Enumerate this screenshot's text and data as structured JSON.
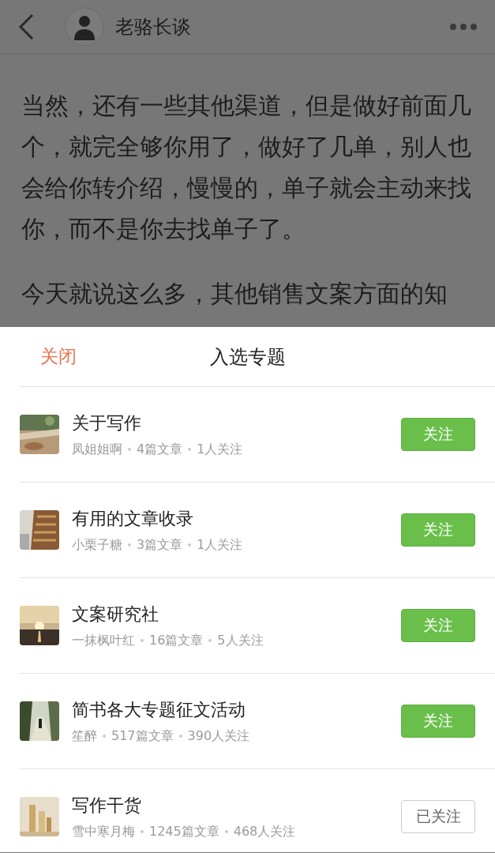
{
  "header": {
    "author": "老骆长谈"
  },
  "article": {
    "paragraphs": [
      "当然，还有一些其他渠道，但是做好前面几个，就完全够你用了，做好了几单，别人也会给你转介绍，慢慢的，单子就会主动来找你，而不是你去找单子了。",
      "今天就说这么多，其他销售文案方面的知"
    ]
  },
  "sheet": {
    "close": "关闭",
    "title": "入选专题",
    "topics": [
      {
        "title": "关于写作",
        "author": "凤姐姐啊",
        "articles": "4篇文章",
        "followers": "1人关注",
        "button": "关注",
        "followed": false
      },
      {
        "title": "有用的文章收录",
        "author": "小栗子糖",
        "articles": "3篇文章",
        "followers": "1人关注",
        "button": "关注",
        "followed": false
      },
      {
        "title": "文案研究社",
        "author": "一抹枫叶红",
        "articles": "16篇文章",
        "followers": "5人关注",
        "button": "关注",
        "followed": false
      },
      {
        "title": "简书各大专题征文活动",
        "author": "笙醉",
        "articles": "517篇文章",
        "followers": "390人关注",
        "button": "关注",
        "followed": false
      },
      {
        "title": "写作干货",
        "author": "雪中寒月梅",
        "articles": "1245篇文章",
        "followers": "468人关注",
        "button": "已关注",
        "followed": true
      }
    ]
  }
}
